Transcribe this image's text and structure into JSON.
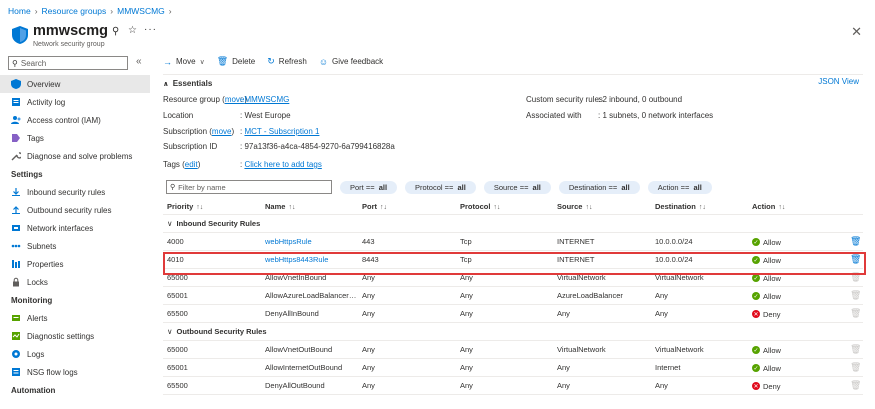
{
  "breadcrumb": [
    "Home",
    "Resource groups",
    "MMWSCMG"
  ],
  "resource": {
    "name": "mmwscmg",
    "type": "Network security group"
  },
  "sidebar": {
    "search_placeholder": "Search",
    "items": [
      {
        "label": "Overview",
        "icon": "shield-icon",
        "active": true
      },
      {
        "label": "Activity log",
        "icon": "activity-log-icon"
      },
      {
        "label": "Access control (IAM)",
        "icon": "iam-icon"
      },
      {
        "label": "Tags",
        "icon": "tag-icon"
      },
      {
        "label": "Diagnose and solve problems",
        "icon": "wrench-icon"
      }
    ],
    "settings_title": "Settings",
    "settings": [
      {
        "label": "Inbound security rules",
        "icon": "inbound-icon"
      },
      {
        "label": "Outbound security rules",
        "icon": "outbound-icon"
      },
      {
        "label": "Network interfaces",
        "icon": "nic-icon"
      },
      {
        "label": "Subnets",
        "icon": "subnet-icon"
      },
      {
        "label": "Properties",
        "icon": "properties-icon"
      },
      {
        "label": "Locks",
        "icon": "lock-icon"
      }
    ],
    "monitoring_title": "Monitoring",
    "monitoring": [
      {
        "label": "Alerts",
        "icon": "alerts-icon"
      },
      {
        "label": "Diagnostic settings",
        "icon": "diagnostic-icon"
      },
      {
        "label": "Logs",
        "icon": "logs-icon"
      },
      {
        "label": "NSG flow logs",
        "icon": "flow-logs-icon"
      }
    ],
    "automation_title": "Automation"
  },
  "toolbar": {
    "move": "Move",
    "delete": "Delete",
    "refresh": "Refresh",
    "feedback": "Give feedback"
  },
  "essentials": {
    "title": "Essentials",
    "json_view": "JSON View",
    "resource_group_label": "Resource group",
    "move": "move",
    "resource_group": "MMWSCMG",
    "location_label": "Location",
    "location": "West Europe",
    "subscription_label": "Subscription",
    "subscription": "MCT - Subscription 1",
    "subscription_id_label": "Subscription ID",
    "subscription_id": "97a13f36-a4ca-4854-9270-6a799416828a",
    "tags_label": "Tags",
    "edit": "edit",
    "tags_value": "Click here to add tags",
    "custom_rules_label": "Custom security rules",
    "custom_rules": "2 inbound, 0 outbound",
    "associated_label": "Associated with",
    "associated": "1 subnets, 0 network interfaces"
  },
  "filter": {
    "placeholder": "Filter by name",
    "pills": [
      {
        "key": "Port ==",
        "value": "all"
      },
      {
        "key": "Protocol ==",
        "value": "all"
      },
      {
        "key": "Source ==",
        "value": "all"
      },
      {
        "key": "Destination ==",
        "value": "all"
      },
      {
        "key": "Action ==",
        "value": "all"
      }
    ]
  },
  "table": {
    "columns": [
      "Priority",
      "Name",
      "Port",
      "Protocol",
      "Source",
      "Destination",
      "Action"
    ],
    "inbound_title": "Inbound Security Rules",
    "outbound_title": "Outbound Security Rules",
    "inbound": [
      {
        "priority": "4000",
        "name": "webHttpsRule",
        "port": "443",
        "protocol": "Tcp",
        "source": "INTERNET",
        "destination": "10.0.0.0/24",
        "action": "Allow",
        "custom": true
      },
      {
        "priority": "4010",
        "name": "webHttps8443Rule",
        "port": "8443",
        "protocol": "Tcp",
        "source": "INTERNET",
        "destination": "10.0.0.0/24",
        "action": "Allow",
        "custom": true
      },
      {
        "priority": "65000",
        "name": "AllowVnetInBound",
        "port": "Any",
        "protocol": "Any",
        "source": "VirtualNetwork",
        "destination": "VirtualNetwork",
        "action": "Allow",
        "custom": false
      },
      {
        "priority": "65001",
        "name": "AllowAzureLoadBalancerIn...",
        "port": "Any",
        "protocol": "Any",
        "source": "AzureLoadBalancer",
        "destination": "Any",
        "action": "Allow",
        "custom": false
      },
      {
        "priority": "65500",
        "name": "DenyAllInBound",
        "port": "Any",
        "protocol": "Any",
        "source": "Any",
        "destination": "Any",
        "action": "Deny",
        "custom": false
      }
    ],
    "outbound": [
      {
        "priority": "65000",
        "name": "AllowVnetOutBound",
        "port": "Any",
        "protocol": "Any",
        "source": "VirtualNetwork",
        "destination": "VirtualNetwork",
        "action": "Allow",
        "custom": false
      },
      {
        "priority": "65001",
        "name": "AllowInternetOutBound",
        "port": "Any",
        "protocol": "Any",
        "source": "Any",
        "destination": "Internet",
        "action": "Allow",
        "custom": false
      },
      {
        "priority": "65500",
        "name": "DenyAllOutBound",
        "port": "Any",
        "protocol": "Any",
        "source": "Any",
        "destination": "Any",
        "action": "Deny",
        "custom": false
      }
    ]
  },
  "colors": {
    "accent": "#0078d4",
    "allow": "#57a300",
    "deny": "#e00b1c",
    "highlight": "#e03a3a"
  }
}
